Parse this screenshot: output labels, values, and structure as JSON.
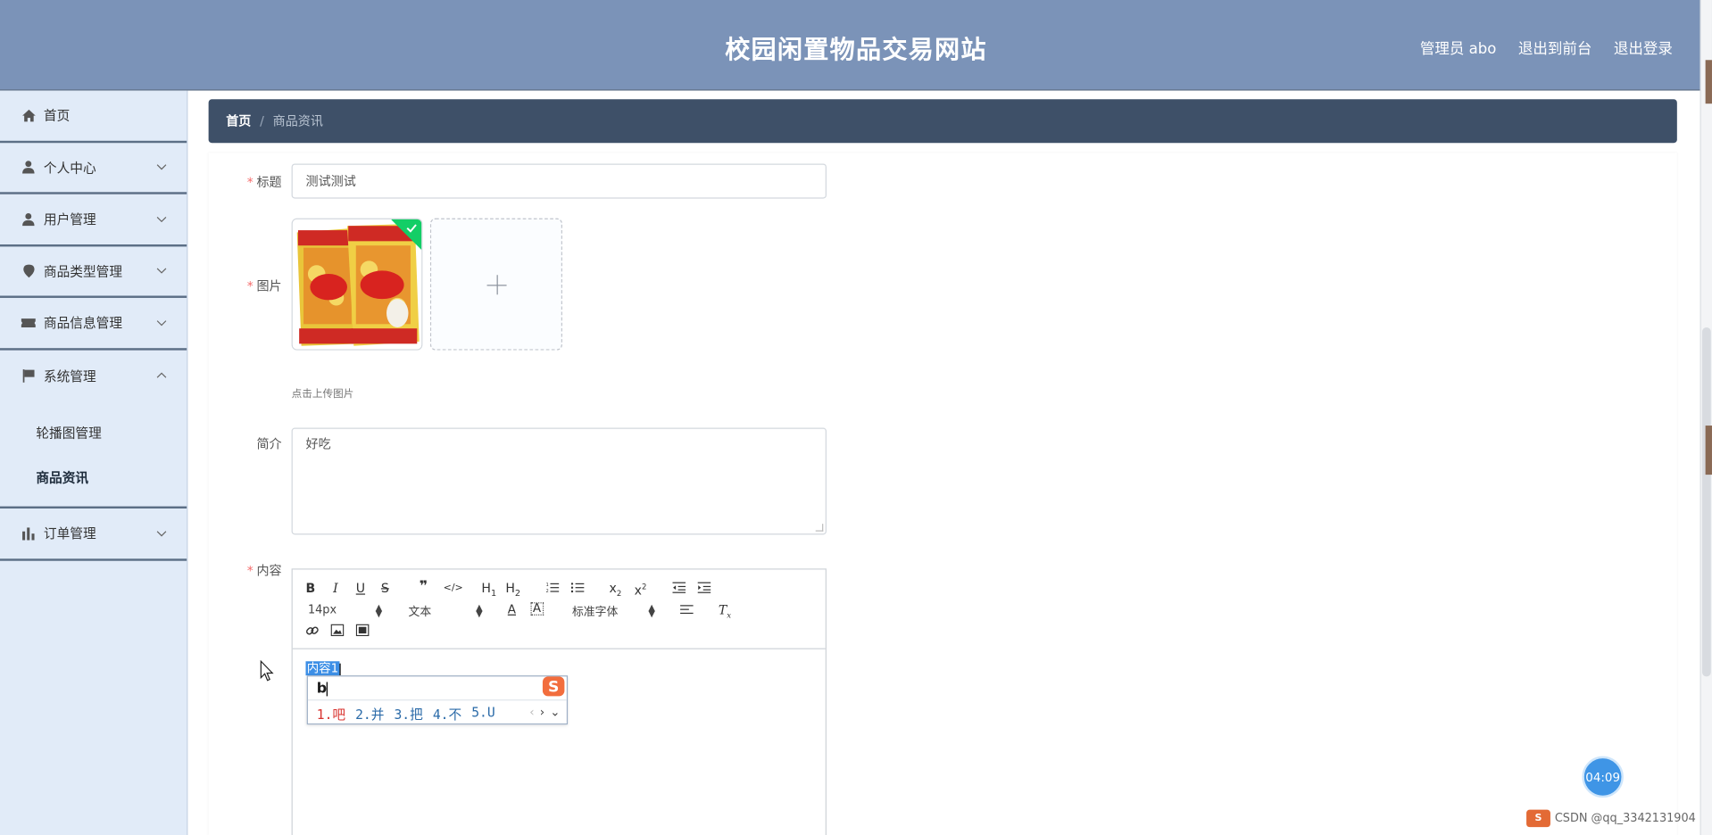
{
  "header": {
    "site_title": "校园闲置物品交易网站",
    "admin_label": "管理员 abo",
    "front_label": "退出到前台",
    "logout_label": "退出登录"
  },
  "sidebar": {
    "items": [
      {
        "label": "首页",
        "icon": "home-icon"
      },
      {
        "label": "个人中心",
        "icon": "user-icon"
      },
      {
        "label": "用户管理",
        "icon": "user-icon"
      },
      {
        "label": "商品类型管理",
        "icon": "location-icon"
      },
      {
        "label": "商品信息管理",
        "icon": "ticket-icon"
      },
      {
        "label": "系统管理",
        "icon": "flag-icon"
      },
      {
        "label": "订单管理",
        "icon": "chart-icon"
      }
    ],
    "system_sub": [
      {
        "label": "轮播图管理"
      },
      {
        "label": "商品资讯"
      }
    ]
  },
  "breadcrumb": {
    "home": "首页",
    "separator": "/",
    "current": "商品资讯"
  },
  "form": {
    "title_label": "标题",
    "title_value": "测试测试",
    "image_label": "图片",
    "upload_tip": "点击上传图片",
    "intro_label": "简介",
    "intro_value": "好吃",
    "content_label": "内容"
  },
  "editor": {
    "font_size": "14px",
    "format": "文本",
    "font_family": "标准字体",
    "selected_text": "内容1"
  },
  "ime": {
    "pinyin": "b",
    "candidates": [
      "1.吧",
      "2.并",
      "3.把",
      "4.不",
      "5.U"
    ]
  },
  "timer": "04:09",
  "taskbar": "CSDN @qq_3342131904",
  "colors": {
    "header_bg": "#7b93b8",
    "sidebar_bg": "#e1ebf8",
    "breadcrumb_bg": "#3e5068",
    "required": "#f56c6c",
    "success": "#13ce66",
    "accent": "#3f95e6"
  }
}
